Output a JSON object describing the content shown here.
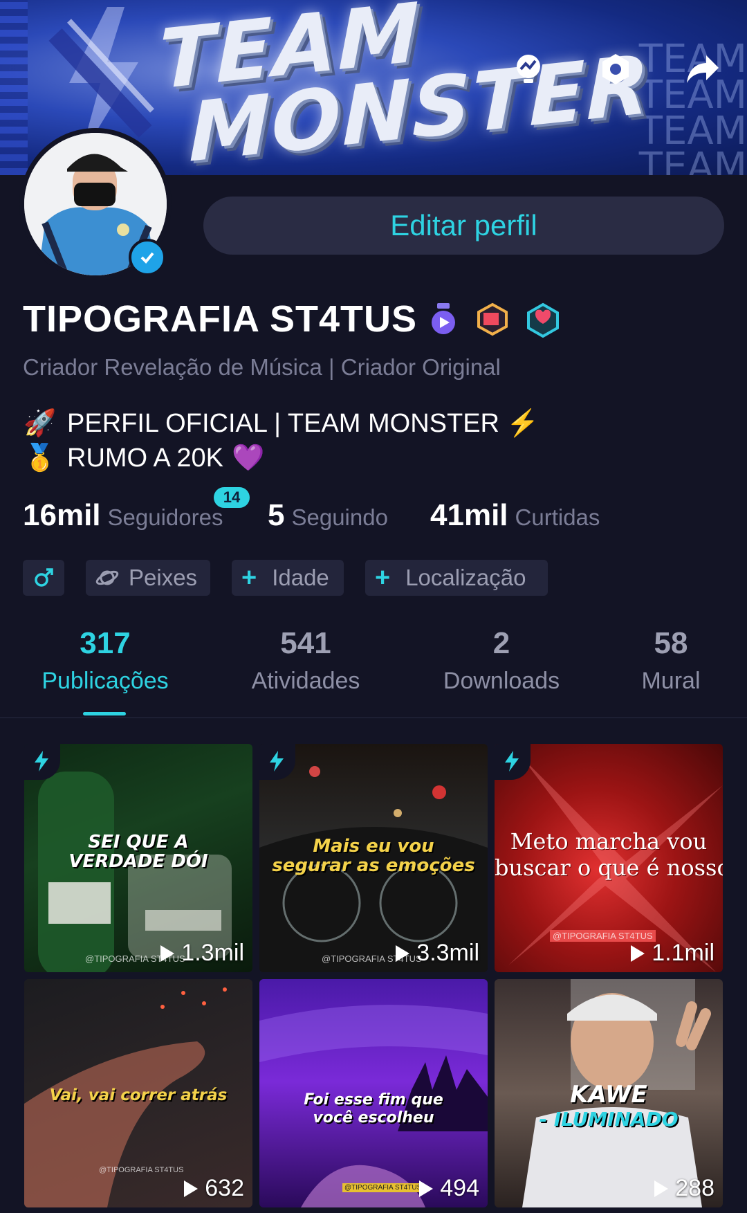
{
  "banner": {
    "title_line1": "TEAM",
    "title_line2": "MONSTER",
    "side_text": "TEAM\nTEAM\nTEAM\nTEAM"
  },
  "top_icons": [
    "creator-insights-icon",
    "settings-hexagon-icon",
    "share-arrow-icon"
  ],
  "profile": {
    "edit_button": "Editar perfil",
    "name": "TIPOGRAFIA ST4TUS",
    "subtitle": "Criador Revelação de Música | Criador Original",
    "bio_line1": "PERFIL OFICIAL | TEAM MONSTER",
    "bio_line2": "RUMO A 20K",
    "bio_emoji1": "🚀",
    "bio_emoji_end1": "⚡",
    "bio_emoji2": "🥇",
    "bio_emoji_end2": "💜"
  },
  "stats": {
    "followers_value": "16mil",
    "followers_label": "Seguidores",
    "followers_badge": "14",
    "following_value": "5",
    "following_label": "Seguindo",
    "likes_value": "41mil",
    "likes_label": "Curtidas"
  },
  "chips": {
    "gender_icon": "male-icon",
    "sign": "Peixes",
    "age": "Idade",
    "location": "Localização",
    "plus": "+"
  },
  "tabs": [
    {
      "count": "317",
      "label": "Publicações",
      "active": true
    },
    {
      "count": "541",
      "label": "Atividades"
    },
    {
      "count": "2",
      "label": "Downloads"
    },
    {
      "count": "58",
      "label": "Mural"
    }
  ],
  "posts": [
    {
      "caption": "SEI QUE A\nVERDADE DÓI",
      "views": "1.3mil",
      "watermark": "@TIPOGRAFIA ST4TUS"
    },
    {
      "caption": "Mais eu vou\nsegurar as emoções",
      "views": "3.3mil",
      "watermark": "@TIPOGRAFIA ST4TUS"
    },
    {
      "caption": "Meto marcha vou\nbuscar o que é nosso",
      "views": "1.1mil",
      "watermark": "@TIPOGRAFIA ST4TUS"
    },
    {
      "caption": "Vai, vai correr atrás",
      "views": "632",
      "watermark": "@TIPOGRAFIA ST4TUS"
    },
    {
      "caption": "Foi esse fim que\nvocê escolheu",
      "views": "494",
      "watermark": "@TIPOGRAFIA ST4TUS"
    },
    {
      "caption": "KAWE\n- ILUMINADO",
      "views": "288"
    }
  ]
}
